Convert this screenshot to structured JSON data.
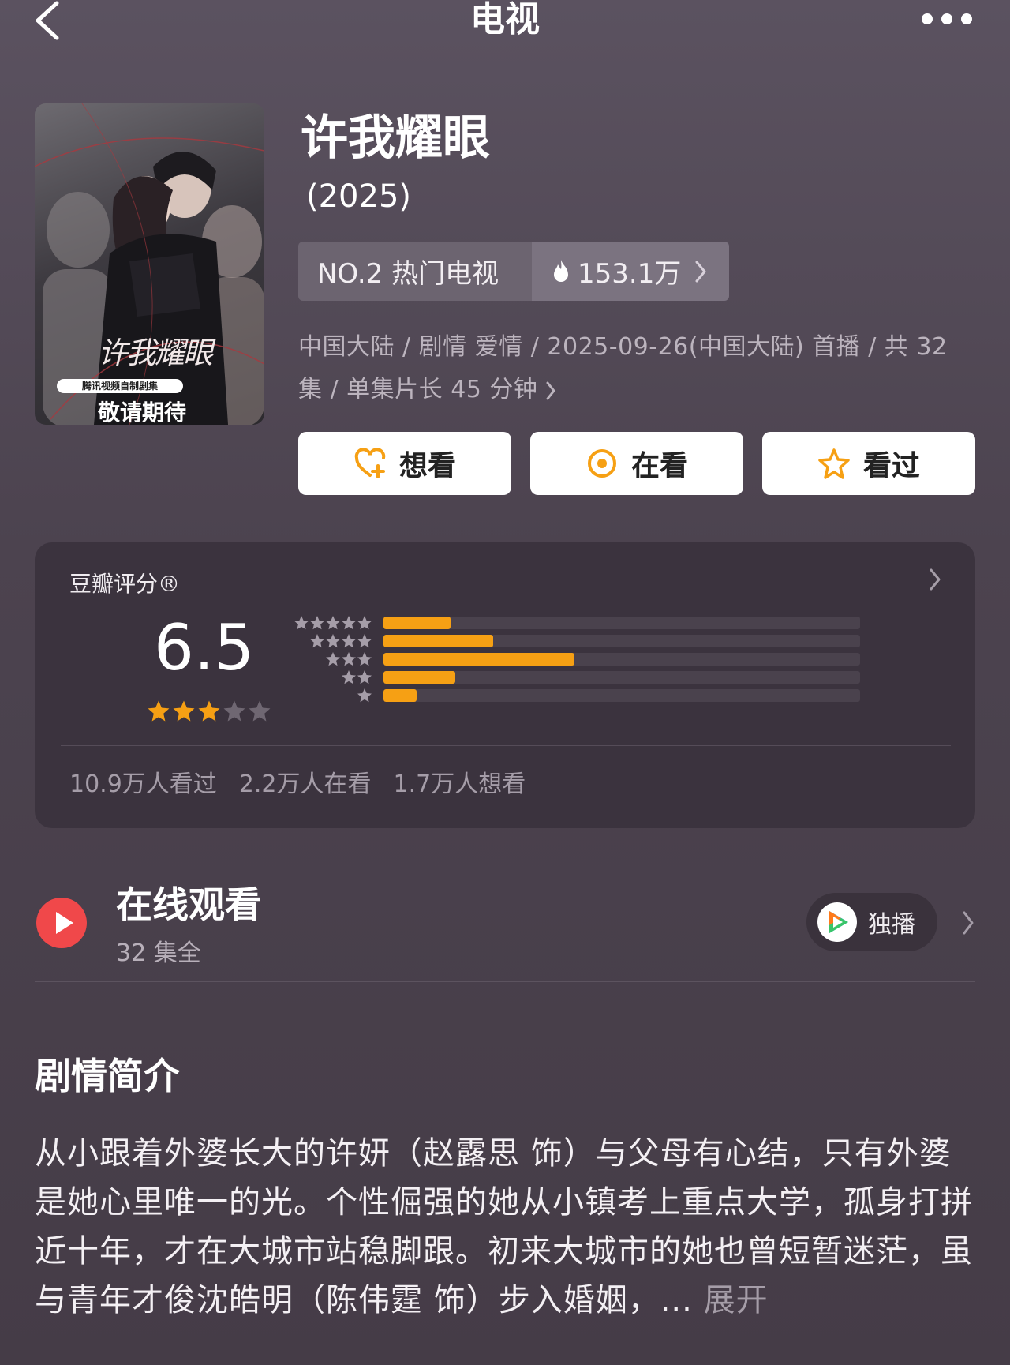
{
  "nav": {
    "title": "电视"
  },
  "poster": {
    "tag": "腾讯视频自制剧集",
    "cta": "敬请期待",
    "logo_text": "许我耀眼"
  },
  "show": {
    "title": "许我耀眼",
    "year": "(2025)",
    "rank_label": "NO.2 热门电视",
    "heat": "153.1万",
    "meta_line1": "中国大陆 / 剧情 爱情 / 2025-09-26(中国大陆) 首播 / 共 32",
    "meta_line2": "集 / 单集片长 45 分钟"
  },
  "actions": {
    "want": "想看",
    "watching": "在看",
    "watched": "看过"
  },
  "rating": {
    "label": "豆瓣评分®",
    "score": "6.5",
    "stars_filled": 3,
    "stars_total": 5,
    "distribution": [
      {
        "stars": 5,
        "fraction": 0.14
      },
      {
        "stars": 4,
        "fraction": 0.23
      },
      {
        "stars": 3,
        "fraction": 0.4
      },
      {
        "stars": 2,
        "fraction": 0.15
      },
      {
        "stars": 1,
        "fraction": 0.07
      }
    ],
    "watched_count": "10.9万人看过",
    "watching_count": "2.2万人在看",
    "want_count": "1.7万人想看"
  },
  "online": {
    "title": "在线观看",
    "subtitle": "32 集全",
    "badge": "独播"
  },
  "synopsis": {
    "title": "剧情简介",
    "text": "从小跟着外婆长大的许妍（赵露思 饰）与父母有心结，只有外婆是她心里唯一的光。个性倔强的她从小镇考上重点大学，孤身打拼近十年，才在大城市站稳脚跟。初来大城市的她也曾短暂迷茫，虽与青年才俊沈皓明（陈伟霆 饰）步入婚姻，... ",
    "expand": "展开"
  },
  "colors": {
    "accent": "#f6a014",
    "play_red": "#f0484a"
  }
}
